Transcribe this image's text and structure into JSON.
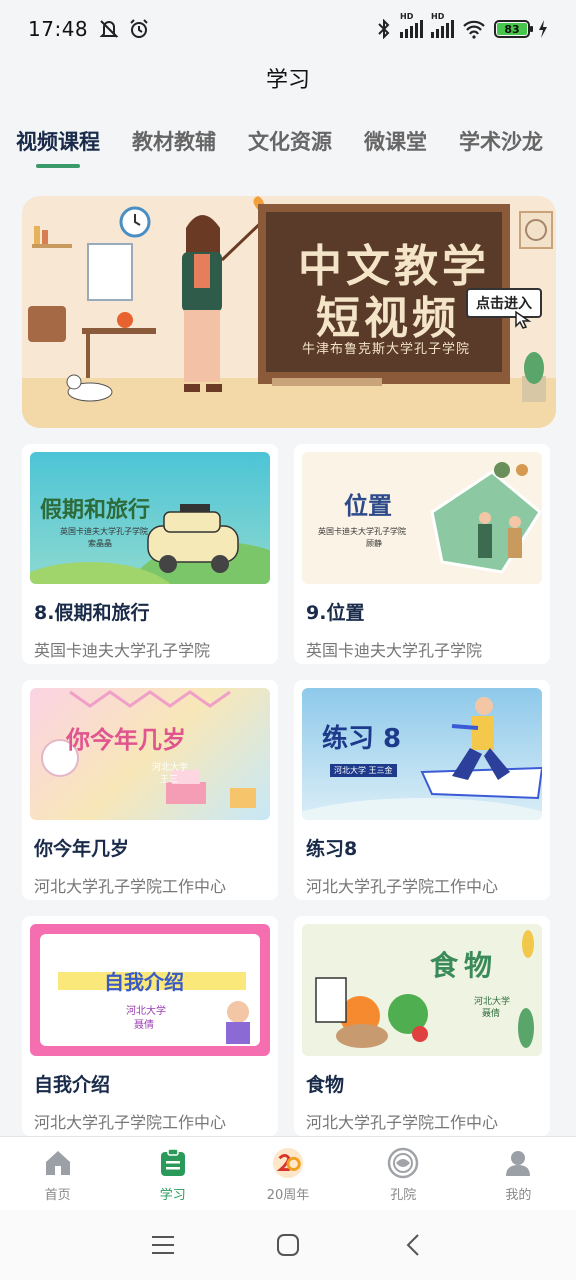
{
  "status_bar": {
    "time": "17:48",
    "battery": "83"
  },
  "header": {
    "title": "学习"
  },
  "tabs": [
    {
      "label": "视频课程",
      "active": true
    },
    {
      "label": "教材教辅"
    },
    {
      "label": "文化资源"
    },
    {
      "label": "微课堂"
    },
    {
      "label": "学术沙龙"
    }
  ],
  "banner": {
    "headline_line1": "中文教学",
    "headline_line2": "短视频",
    "subtitle": "牛津布鲁克斯大学孔子学院",
    "cta": "点击进入"
  },
  "courses": [
    {
      "title": "8.假期和旅行",
      "org": "英国卡迪夫大学孔子学院",
      "thumb_text": "假期和旅行",
      "thumb_small": "英国卡迪夫大学孔子学院",
      "thumb_author": "索晶晶"
    },
    {
      "title": "9.位置",
      "org": "英国卡迪夫大学孔子学院",
      "thumb_text": "位置",
      "thumb_small": "英国卡迪夫大学孔子学院",
      "thumb_author": "顾静"
    },
    {
      "title": "你今年几岁",
      "org": "河北大学孔子学院工作中心",
      "thumb_text": "你今年几岁",
      "thumb_small": "河北大学",
      "thumb_author": "王三"
    },
    {
      "title": "练习8",
      "org": "河北大学孔子学院工作中心",
      "thumb_text": "练习 8",
      "thumb_small": "河北大学 王三金",
      "thumb_author": ""
    },
    {
      "title": "自我介绍",
      "org": "河北大学孔子学院工作中心",
      "thumb_text": "自我介绍",
      "thumb_small": "河北大学",
      "thumb_author": "聂倩"
    },
    {
      "title": "食物",
      "org": "河北大学孔子学院工作中心",
      "thumb_text": "食物",
      "thumb_small": "河北大学",
      "thumb_author": "聂倩"
    }
  ],
  "bottom_nav": [
    {
      "label": "首页",
      "icon": "home-icon"
    },
    {
      "label": "学习",
      "icon": "clipboard-icon",
      "active": true
    },
    {
      "label": "20周年",
      "icon": "anniversary-20-icon"
    },
    {
      "label": "孔院",
      "icon": "institute-logo-icon"
    },
    {
      "label": "我的",
      "icon": "user-icon"
    }
  ],
  "colors": {
    "accent_green": "#3a9a6a",
    "title_navy": "#1a2b4a",
    "banner_board": "#5a3b2a"
  }
}
